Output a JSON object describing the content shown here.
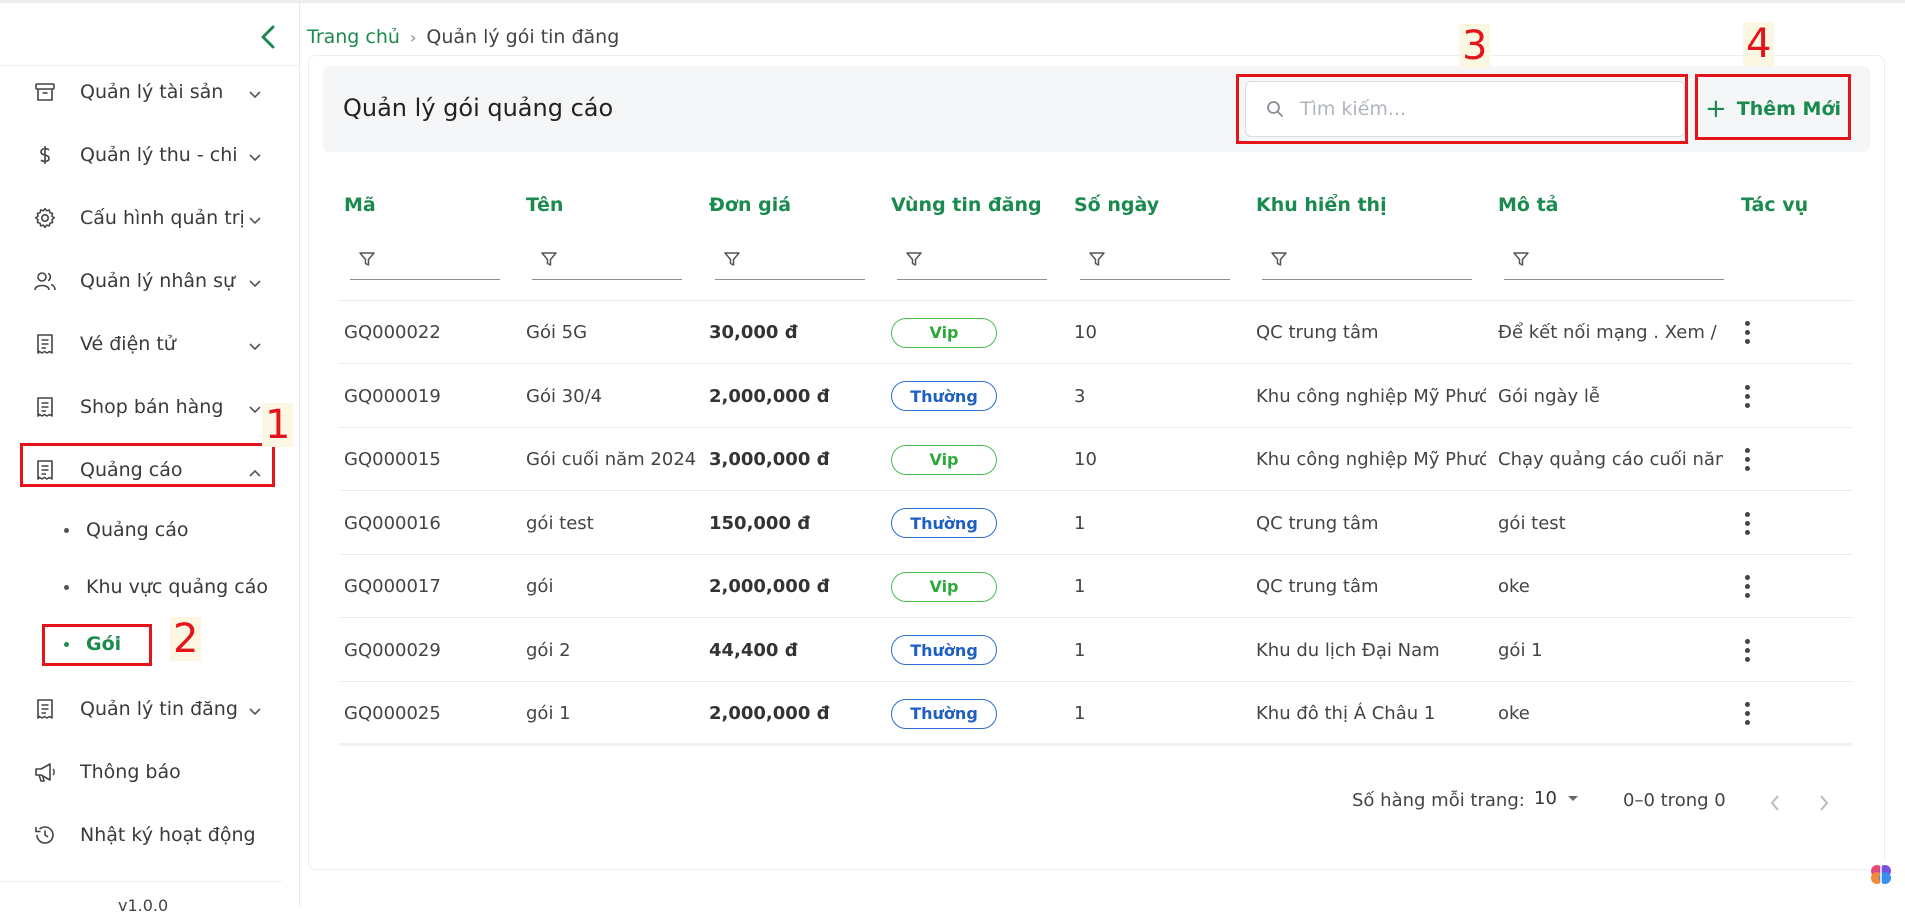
{
  "sidebar": {
    "items": [
      {
        "label": "Quản lý tài sản",
        "icon": "archive-icon"
      },
      {
        "label": "Quản lý thu - chi",
        "icon": "dollar-icon"
      },
      {
        "label": "Cấu hình quản trị",
        "icon": "gear-icon"
      },
      {
        "label": "Quản lý nhân sự",
        "icon": "users-icon"
      },
      {
        "label": "Vé điện tử",
        "icon": "receipt-icon"
      },
      {
        "label": "Shop bán hàng",
        "icon": "receipt-icon"
      },
      {
        "label": "Quảng cáo",
        "icon": "receipt-icon",
        "expanded": true
      },
      {
        "label": "Quản lý tin đăng",
        "icon": "receipt-icon"
      },
      {
        "label": "Thông báo",
        "icon": "megaphone-icon"
      },
      {
        "label": "Nhật ký hoạt động",
        "icon": "history-icon"
      }
    ],
    "sub_items": [
      {
        "label": "Quảng cáo",
        "active": false
      },
      {
        "label": "Khu vực quảng cáo",
        "active": false
      },
      {
        "label": "Gói",
        "active": true
      }
    ],
    "version": "v1.0.0"
  },
  "annotations": [
    "1",
    "2",
    "3",
    "4"
  ],
  "breadcrumb": {
    "home": "Trang chủ",
    "separator": "›",
    "current": "Quản lý gói tin đăng"
  },
  "header": {
    "title": "Quản lý gói quảng cáo",
    "search_placeholder": "Tìm kiếm...",
    "add_label": "Thêm Mới",
    "add_icon": "+"
  },
  "table": {
    "columns": [
      "Mã",
      "Tên",
      "Đơn giá",
      "Vùng tin đăng",
      "Số ngày",
      "Khu hiển thị",
      "Mô tả",
      "Tác vụ"
    ],
    "rows": [
      {
        "code": "GQ000022",
        "name": "Gói 5G",
        "price": "30,000 đ",
        "region": "Vip",
        "days": "10",
        "area": "QC trung tâm",
        "desc": "Để kết nối mạng . Xem / lướt"
      },
      {
        "code": "GQ000019",
        "name": "Gói 30/4",
        "price": "2,000,000 đ",
        "region": "Thường",
        "days": "3",
        "area": "Khu công nghiệp Mỹ Phước",
        "desc": "Gói ngày lễ"
      },
      {
        "code": "GQ000015",
        "name": "Gói cuối năm 2024",
        "price": "3,000,000 đ",
        "region": "Vip",
        "days": "10",
        "area": "Khu công nghiệp Mỹ Phước",
        "desc": "Chạy quảng cáo cuối năm"
      },
      {
        "code": "GQ000016",
        "name": "gói test",
        "price": "150,000 đ",
        "region": "Thường",
        "days": "1",
        "area": "QC trung tâm",
        "desc": "gói test"
      },
      {
        "code": "GQ000017",
        "name": "gói",
        "price": "2,000,000 đ",
        "region": "Vip",
        "days": "1",
        "area": "QC trung tâm",
        "desc": "oke"
      },
      {
        "code": "GQ000029",
        "name": "gói 2",
        "price": "44,400 đ",
        "region": "Thường",
        "days": "1",
        "area": "Khu du lịch Đại Nam",
        "desc": "gói 1"
      },
      {
        "code": "GQ000025",
        "name": "gói 1",
        "price": "2,000,000 đ",
        "region": "Thường",
        "days": "1",
        "area": "Khu đô thị Á Châu 1",
        "desc": "oke"
      }
    ]
  },
  "pagination": {
    "rows_per_page_label": "Số hàng mỗi trang:",
    "rows_per_page": "10",
    "range": "0–0 trong 0"
  },
  "colors": {
    "accent": "#1b8a4e",
    "vip": "#2fa83a",
    "normal": "#1e5fc4",
    "annotation": "#e5141b"
  }
}
